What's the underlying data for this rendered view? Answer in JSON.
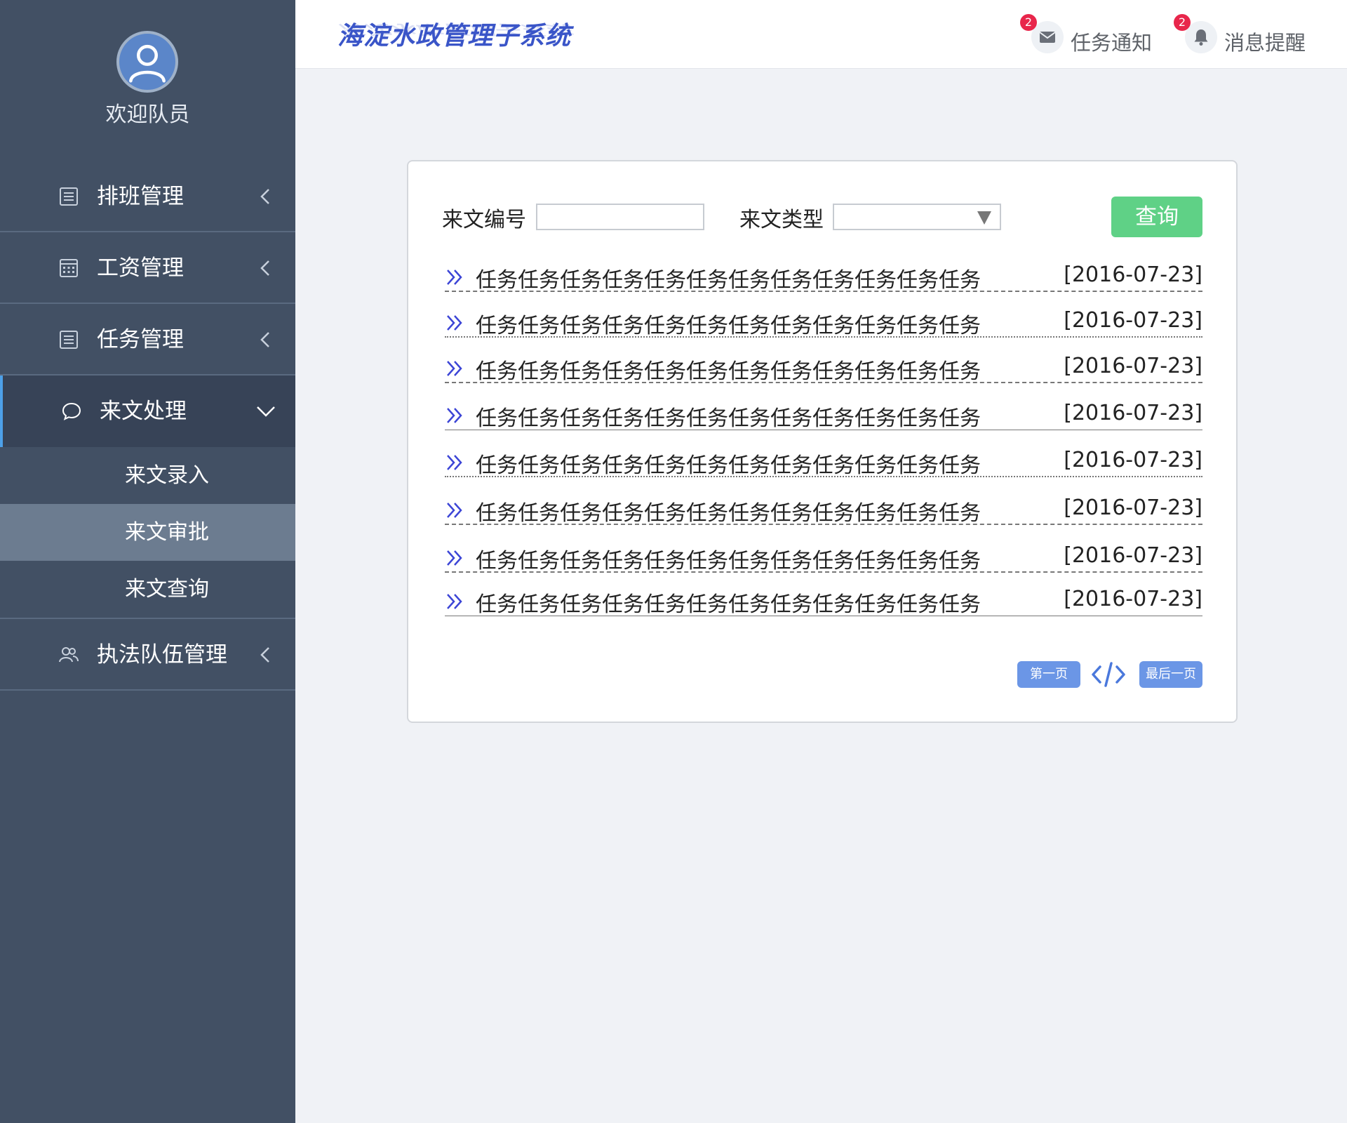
{
  "sidebar": {
    "welcome": "欢迎队员",
    "nav": [
      {
        "label": "排班管理",
        "icon": "list-icon"
      },
      {
        "label": "工资管理",
        "icon": "calendar-grid-icon"
      },
      {
        "label": "任务管理",
        "icon": "list-icon"
      },
      {
        "label": "来文处理",
        "icon": "chat-bubble-icon",
        "expanded": true,
        "children": [
          {
            "label": "来文录入"
          },
          {
            "label": "来文审批",
            "active": true
          },
          {
            "label": "来文查询"
          }
        ]
      },
      {
        "label": "执法队伍管理",
        "icon": "team-icon"
      }
    ]
  },
  "header": {
    "title": "海淀水政管理子系统",
    "task_notice": {
      "label": "任务通知",
      "badge": "2"
    },
    "message_alert": {
      "label": "消息提醒",
      "badge": "2"
    }
  },
  "filters": {
    "doc_number_label": "来文编号",
    "doc_number_value": "",
    "doc_type_label": "来文类型",
    "doc_type_value": "",
    "query_label": "查询"
  },
  "documents": [
    {
      "title": "任务任务任务任务任务任务任务任务任务任务任务任务",
      "date": "[2016-07-23]"
    },
    {
      "title": "任务任务任务任务任务任务任务任务任务任务任务任务",
      "date": "[2016-07-23]"
    },
    {
      "title": "任务任务任务任务任务任务任务任务任务任务任务任务",
      "date": "[2016-07-23]"
    },
    {
      "title": "任务任务任务任务任务任务任务任务任务任务任务任务",
      "date": "[2016-07-23]"
    },
    {
      "title": "任务任务任务任务任务任务任务任务任务任务任务任务",
      "date": "[2016-07-23]"
    },
    {
      "title": "任务任务任务任务任务任务任务任务任务任务任务任务",
      "date": "[2016-07-23]"
    },
    {
      "title": "任务任务任务任务任务任务任务任务任务任务任务任务",
      "date": "[2016-07-23]"
    },
    {
      "title": "任务任务任务任务任务任务任务任务任务任务任务任务",
      "date": "[2016-07-23]"
    }
  ],
  "pager": {
    "first_label": "第一页",
    "last_label": "最后一页"
  },
  "colors": {
    "sidebar_bg": "#425064",
    "accent_blue": "#3a55c8",
    "query_green": "#5fd186",
    "pager_blue": "#6b96e6",
    "badge_red": "#e8264b"
  }
}
